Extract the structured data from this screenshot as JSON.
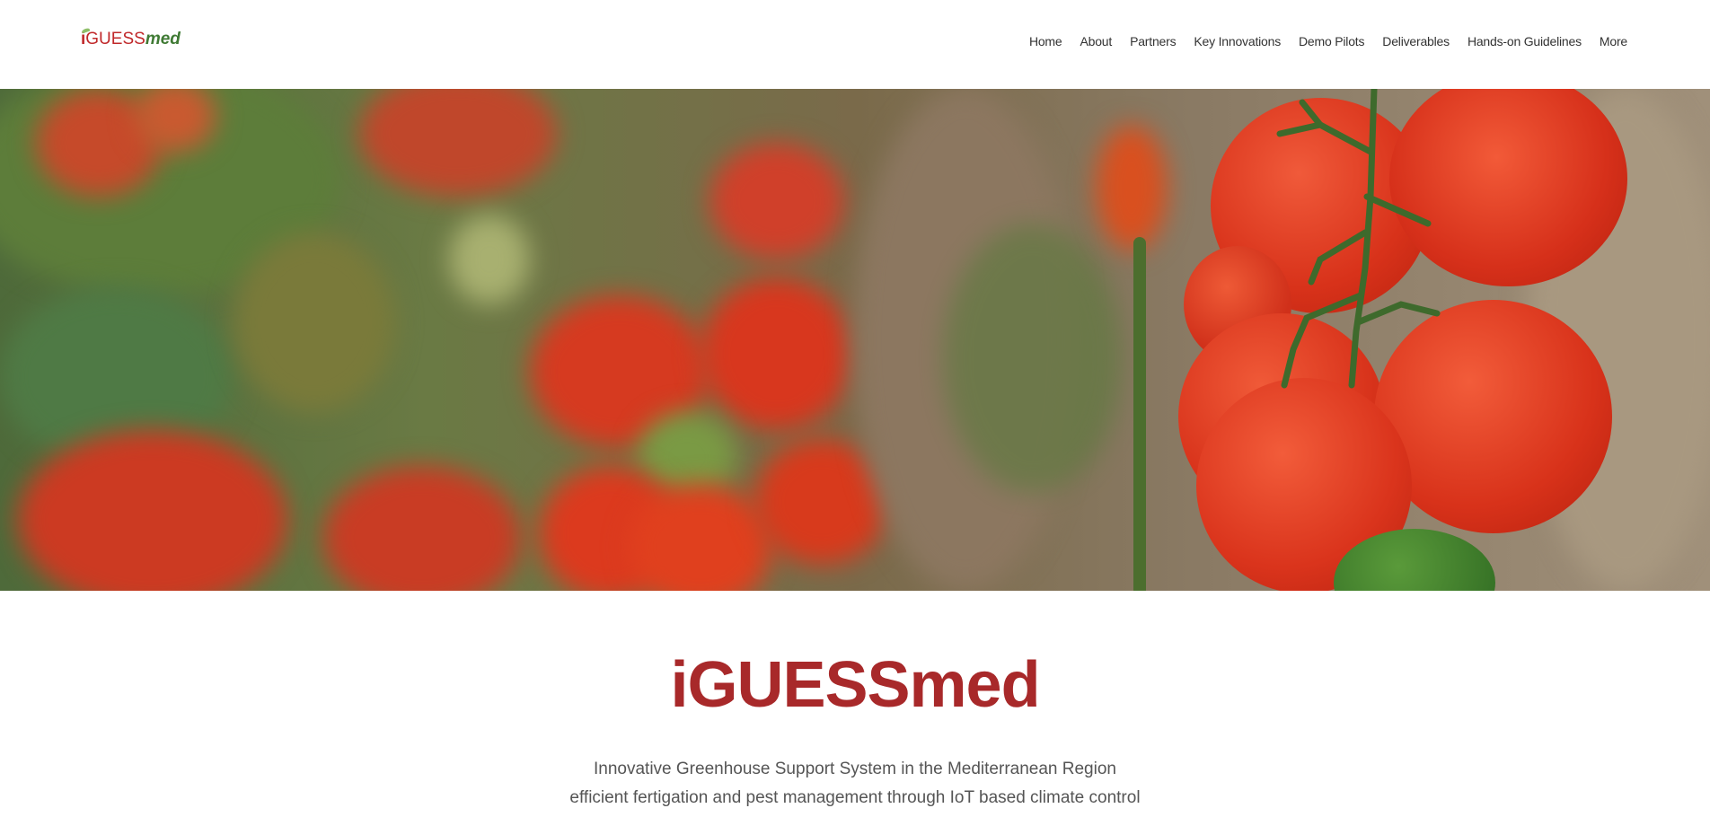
{
  "header": {
    "logo": {
      "i": "i",
      "guess": "GUESS",
      "med": "med"
    },
    "nav": [
      "Home",
      "About",
      "Partners",
      "Key Innovations",
      "Demo Pilots",
      "Deliverables",
      "Hands-on Guidelines",
      "More"
    ]
  },
  "hero": {
    "image": "tomatoes-on-vine-photo"
  },
  "main": {
    "title": "iGUESSmed",
    "subtitle_line1": "Innovative Greenhouse Support System in the Mediterranean Region",
    "subtitle_line2": "efficient fertigation and pest management through IoT based climate control"
  },
  "colors": {
    "brand_red": "#a8292a",
    "brand_green": "#3f7a34"
  }
}
